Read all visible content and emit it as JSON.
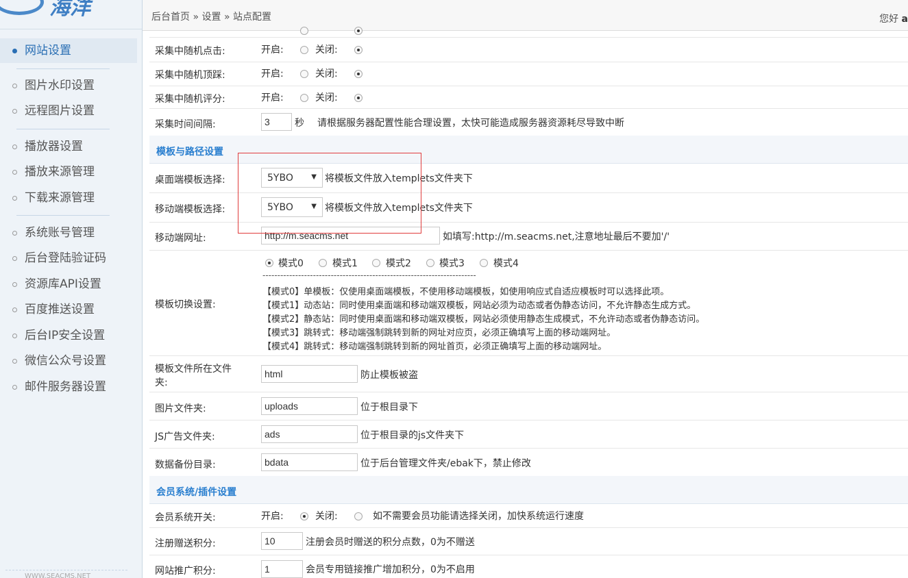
{
  "logo": {
    "text": "海洋"
  },
  "topbar": {
    "breadcrumb": [
      "后台首页",
      "»",
      "设置",
      "»",
      "站点配置"
    ],
    "greeting": "您好",
    "username": "a"
  },
  "sidebar": {
    "items": [
      {
        "label": "网站设置",
        "active": true
      },
      {
        "label": "图片水印设置"
      },
      {
        "label": "远程图片设置"
      },
      {
        "label": "播放器设置"
      },
      {
        "label": "播放来源管理"
      },
      {
        "label": "下载来源管理"
      },
      {
        "label": "系统账号管理"
      },
      {
        "label": "后台登陆验证码"
      },
      {
        "label": "资源库API设置"
      },
      {
        "label": "百度推送设置"
      },
      {
        "label": "后台IP安全设置"
      },
      {
        "label": "微信公众号设置"
      },
      {
        "label": "邮件服务器设置"
      }
    ],
    "footer": "WWW.SEACMS.NET"
  },
  "form": {
    "on_label": "开启:",
    "off_label": "关闭:",
    "random_click": {
      "label": "采集中随机点击:",
      "value": "off"
    },
    "random_dig": {
      "label": "采集中随机顶踩:",
      "value": "off"
    },
    "random_rate": {
      "label": "采集中随机评分:",
      "value": "off"
    },
    "interval": {
      "label": "采集时间间隔:",
      "value": "3",
      "unit": "秒",
      "hint": "请根据服务器配置性能合理设置，太快可能造成服务器资源耗尽导致中断"
    },
    "section_template": "模板与路径设置",
    "pc_template": {
      "label": "桌面端模板选择:",
      "value": "5YBO",
      "hint": "将模板文件放入templets文件夹下"
    },
    "mobile_template": {
      "label": "移动端模板选择:",
      "value": "5YBO",
      "hint": "将模板文件放入templets文件夹下"
    },
    "mobile_url": {
      "label": "移动端网址:",
      "value": "http://m.seacms.net",
      "hint": "如填写:http://m.seacms.net,注意地址最后不要加'/'"
    },
    "template_mode": {
      "label": "模板切换设置:",
      "options": [
        "模式0",
        "模式1",
        "模式2",
        "模式3",
        "模式4"
      ],
      "selected": 0,
      "dashes": "------------------------------------------------------------------------",
      "descriptions": [
        "【模式0】单模板：仅使用桌面端模板，不使用移动端模板，如使用响应式自适应模板时可以选择此项。",
        "【模式1】动态站：同时使用桌面端和移动端双模板，网站必须为动态或者伪静态访问，不允许静态生成方式。",
        "【模式2】静态站：同时使用桌面端和移动端双模板，网站必须使用静态生成模式，不允许动态或者伪静态访问。",
        "【模式3】跳转式：移动端强制跳转到新的网址对应页，必须正确填写上面的移动端网址。",
        "【模式4】跳转式：移动端强制跳转到新的网址首页，必须正确填写上面的移动端网址。"
      ]
    },
    "template_dir": {
      "label_line1": "模板文件所在文件",
      "label_line2": "夹:",
      "value": "html",
      "hint": "防止模板被盗"
    },
    "image_dir": {
      "label": "图片文件夹:",
      "value": "uploads",
      "hint": "位于根目录下"
    },
    "js_ad_dir": {
      "label": "JS广告文件夹:",
      "value": "ads",
      "hint": "位于根目录的js文件夹下"
    },
    "backup_dir": {
      "label": "数据备份目录:",
      "value": "bdata",
      "hint": "位于后台管理文件夹/ebak下，禁止修改"
    },
    "section_member": "会员系统/插件设置",
    "member_switch": {
      "label": "会员系统开关:",
      "value": "on",
      "hint": "如不需要会员功能请选择关闭，加快系统运行速度"
    },
    "register_points": {
      "label": "注册赠送积分:",
      "value": "10",
      "hint": "注册会员时赠送的积分点数，0为不赠送"
    },
    "promo_points": {
      "label": "网站推广积分:",
      "value": "1",
      "hint": "会员专用链接推广增加积分，0为不启用"
    }
  }
}
